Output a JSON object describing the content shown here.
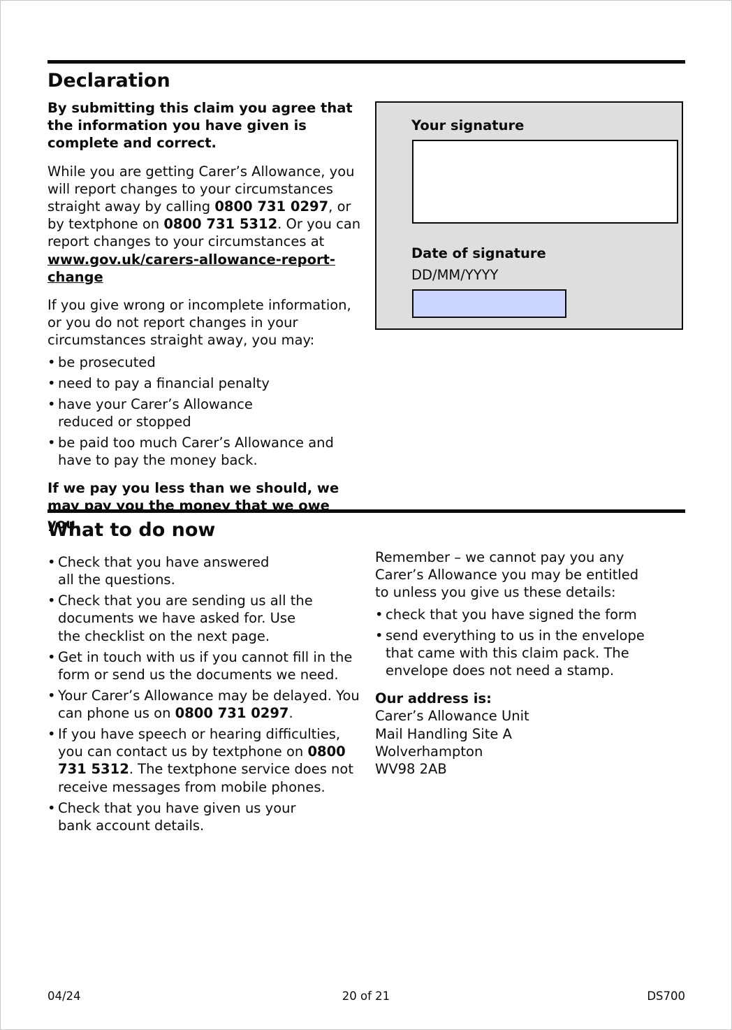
{
  "declaration": {
    "title": "Declaration",
    "intro": "By submitting this claim you agree that the information you have given is complete and correct.",
    "report": {
      "text1": "While you are getting Carer’s Allowance, you will report changes to your circumstances straight away by calling ",
      "phone": "0800 731 0297",
      "text2": ", or by textphone on ",
      "textphone": "0800 731 5312",
      "text3": ". Or you can report changes to your circumstances at ",
      "link": "www.gov.uk/carers-allowance-report-change"
    },
    "consequences_intro": "If you give wrong or incomplete information, or you do not report changes in your circumstances straight away, you may:",
    "consequences": [
      "be prosecuted",
      "need to pay a financial penalty",
      "have your Carer’s Allowance reduced or stopped",
      "be paid too much Carer’s Allowance and have to pay the money back."
    ],
    "underpay": "If we pay you less than we should, we may pay you the money that we owe you."
  },
  "signature_box": {
    "signature_label": "Your signature",
    "signature_value": "",
    "date_label": "Date of signature",
    "date_hint": "DD/MM/YYYY",
    "date_value": ""
  },
  "what_to_do": {
    "title": "What to do now",
    "check1": "Check that you have answered all the questions.",
    "check2": "Check that you are sending us all the documents we have asked for. Use the checklist on the next page.",
    "check3": "Get in touch with us if you cannot fill in the form or send us the documents we need.",
    "delay_text": "Your Carer’s Allowance may be delayed. You can phone us on ",
    "delay_phone": "0800 731 0297",
    "delay_end": ".",
    "speech_text": "If you have speech or hearing difficulties, you can contact us by textphone on ",
    "speech_phone": "0800 731 5312",
    "speech_end": ". The textphone service does not receive messages from mobile phones.",
    "check6": "Check that you have given us your bank account details."
  },
  "remember": {
    "text": "Remember – we cannot pay you any Carer’s Allowance you may be entitled to unless you give us these details:",
    "items": [
      "check that you have signed the form",
      "send everything to us in the envelope that came with this claim pack. The envelope does not need a stamp."
    ]
  },
  "address": {
    "label": "Our address is:",
    "lines": [
      "Carer’s Allowance Unit",
      "Mail Handling Site A",
      "Wolverhampton",
      "WV98 2AB"
    ]
  },
  "footer": {
    "date": "04/24",
    "page": "20 of 21",
    "code": "DS700"
  }
}
